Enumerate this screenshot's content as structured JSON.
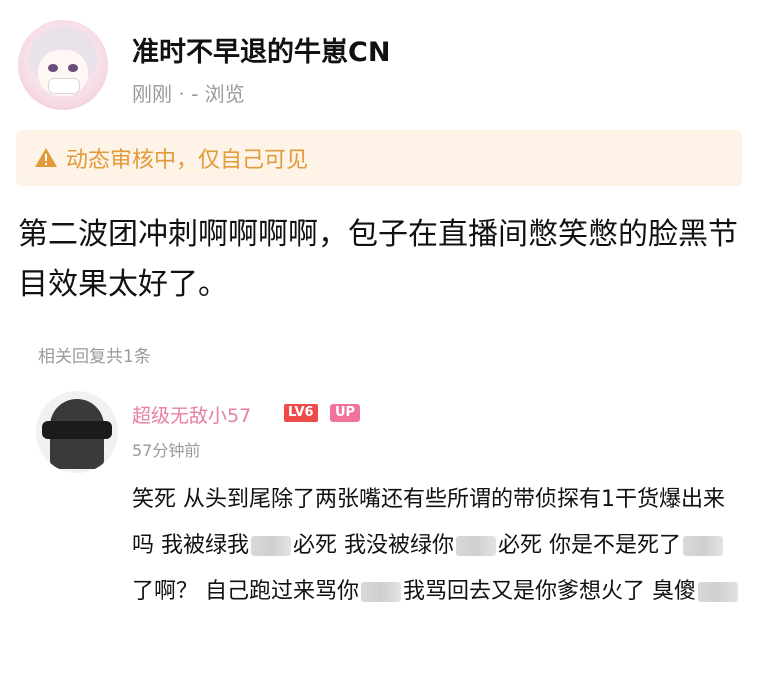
{
  "post": {
    "author": "准时不早退的牛崽CN",
    "meta": "刚刚 · - 浏览",
    "notice": "动态审核中，仅自己可见",
    "content": "第二波团冲刺啊啊啊啊，包子在直播间憋笑憋的脸黑节目效果太好了。"
  },
  "replies": {
    "count_label": "相关回复共1条",
    "items": [
      {
        "name": "超级无敌小57",
        "level_badge": "LV6",
        "up_badge": "UP",
        "time": "57分钟前",
        "segments": [
          "笑死 从头到尾除了两张嘴还有些所谓的带侦探有1干货爆出来吗 我被绿我",
          "必死 我没被绿你",
          "必死 你是不是死了",
          "了啊？ 自己跑过来骂你",
          "我骂回去又是你爹想火了 臭傻"
        ]
      }
    ]
  },
  "colors": {
    "notice_bg": "#fdf3e6",
    "notice_text": "#e39a3b",
    "reply_name": "#e67fa0",
    "level_badge": "#ef4b4b",
    "up_badge": "#f0739a",
    "meta_gray": "#9a9a9a"
  },
  "icons": {
    "warning": "warning-triangle-icon"
  }
}
